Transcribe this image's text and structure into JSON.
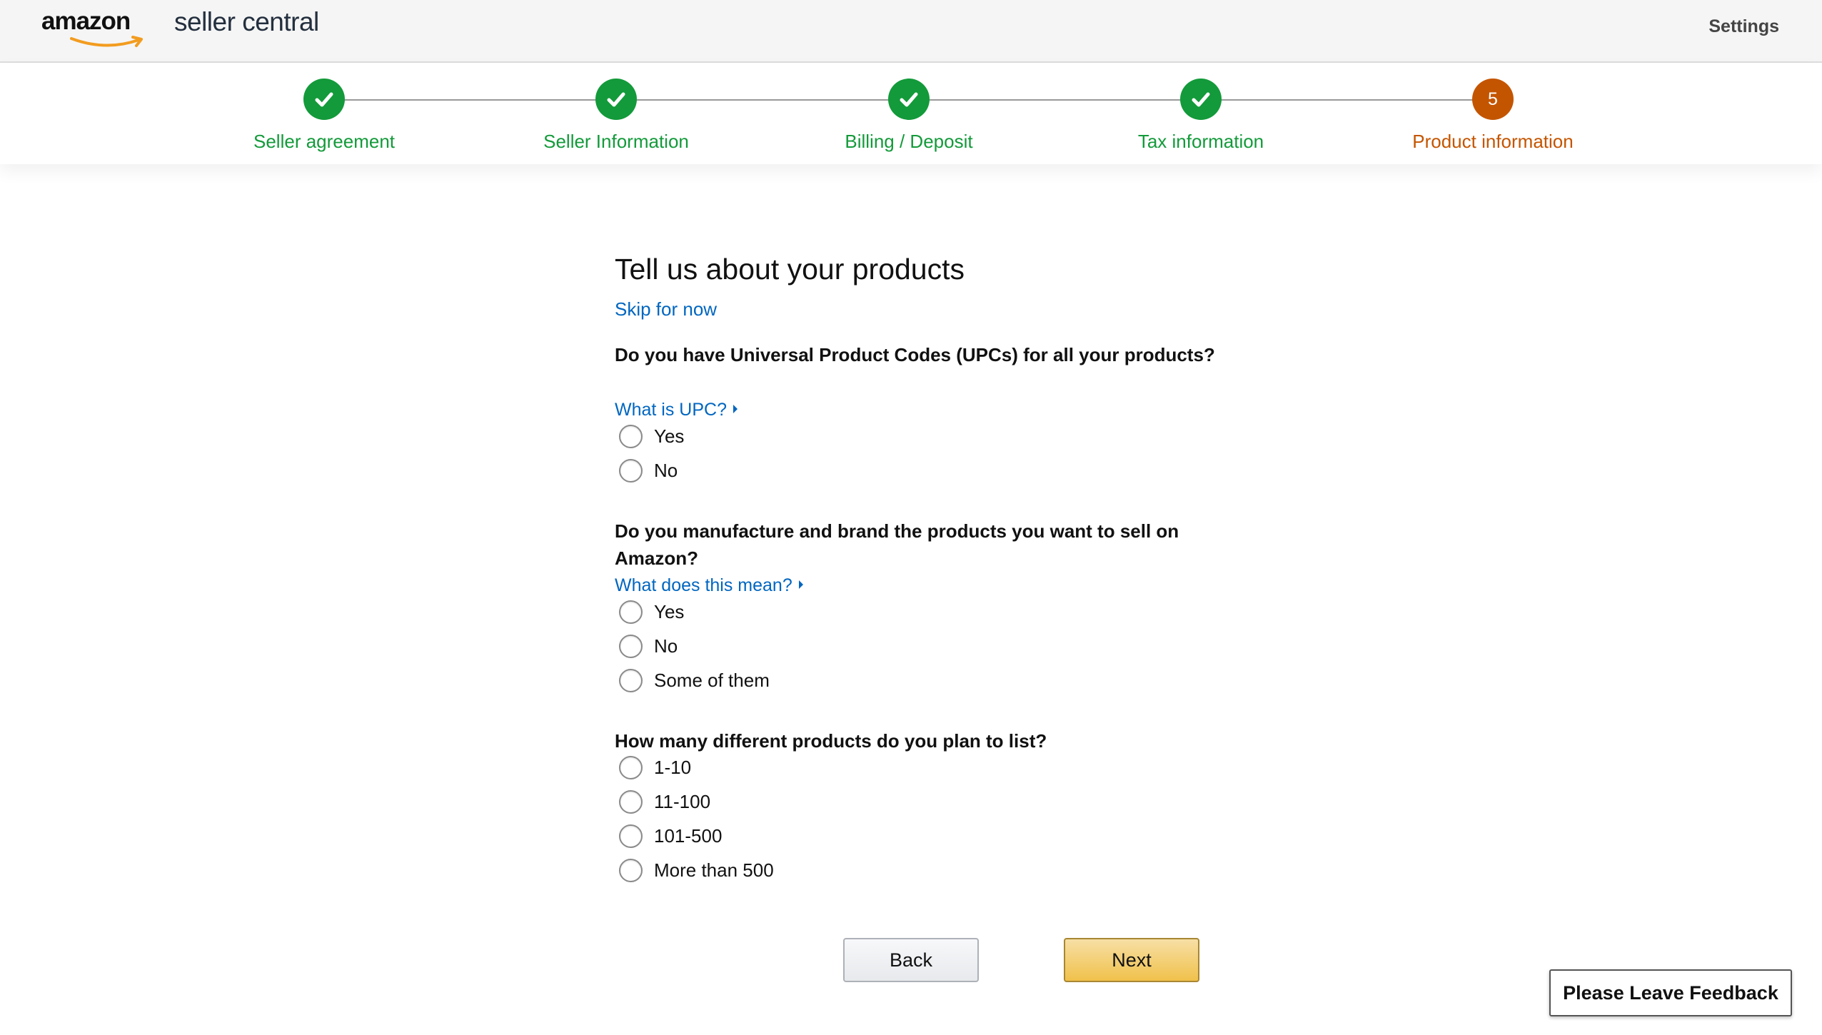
{
  "header": {
    "logo_amazon": "amazon",
    "logo_rest": "seller central",
    "settings_label": "Settings"
  },
  "stepper": {
    "steps": [
      {
        "label": "Seller agreement",
        "status": "complete"
      },
      {
        "label": "Seller Information",
        "status": "complete"
      },
      {
        "label": "Billing / Deposit",
        "status": "complete"
      },
      {
        "label": "Tax information",
        "status": "complete"
      },
      {
        "label": "Product information",
        "status": "current",
        "number": "5"
      }
    ],
    "colors": {
      "complete": "#139a3a",
      "current": "#c45500"
    }
  },
  "form": {
    "title": "Tell us about your products",
    "skip_link": "Skip for now",
    "questions": [
      {
        "text": "Do you have Universal Product Codes (UPCs) for all your products?",
        "help": "What is UPC?",
        "options": [
          "Yes",
          "No"
        ]
      },
      {
        "text": "Do you manufacture and brand the products you want to sell on Amazon?",
        "help": "What does this mean?",
        "options": [
          "Yes",
          "No",
          "Some of them"
        ]
      },
      {
        "text": "How many different products do you plan to list?",
        "options": [
          "1-10",
          "11-100",
          "101-500",
          "More than 500"
        ]
      }
    ]
  },
  "buttons": {
    "back": "Back",
    "next": "Next",
    "feedback": "Please Leave Feedback"
  },
  "colors": {
    "link": "#0066c0",
    "next_button": "#f0c14b"
  }
}
